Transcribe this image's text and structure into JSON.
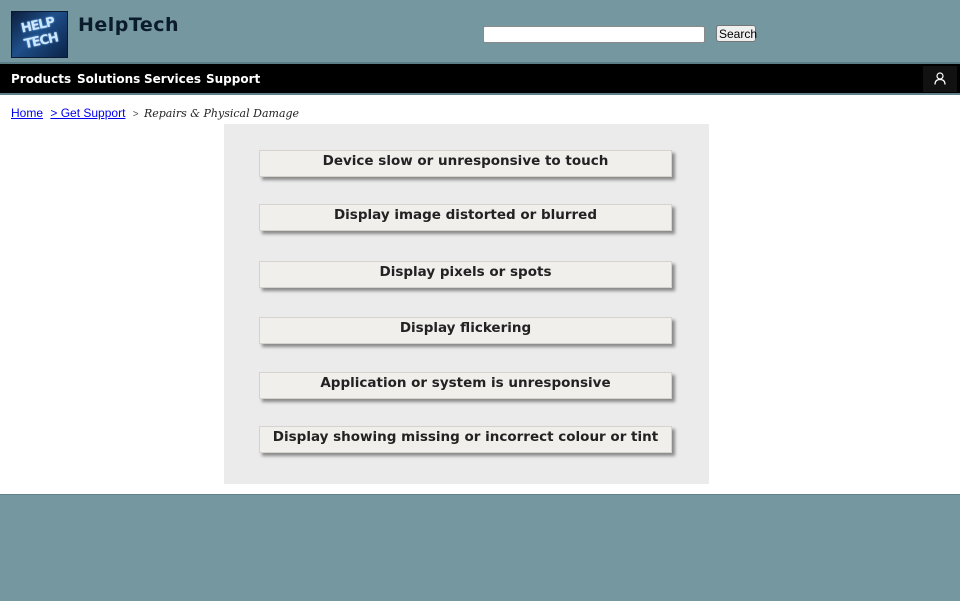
{
  "header": {
    "brand": "HelpTech",
    "logo_text": [
      "HELP",
      "TECH"
    ],
    "search_placeholder": "",
    "search_button": "Search"
  },
  "nav": {
    "items": [
      "Products",
      "Solutions",
      "Services",
      "Support"
    ],
    "user_icon": "user-icon"
  },
  "breadcrumb": {
    "home": "Home",
    "get_support": "> Get Support",
    "separator": ">",
    "current": "Repairs & Physical Damage"
  },
  "issues": [
    "Device slow or unresponsive to touch",
    "Display image distorted or blurred",
    "Display pixels or spots",
    "Display flickering",
    "Application or system is unresponsive",
    "Display showing missing or incorrect colour or tint"
  ],
  "colors": {
    "background": "#75979f",
    "navbar": "#000000",
    "panel": "#ebebeb",
    "issue_card": "#f1efec",
    "link": "#0000ee"
  }
}
